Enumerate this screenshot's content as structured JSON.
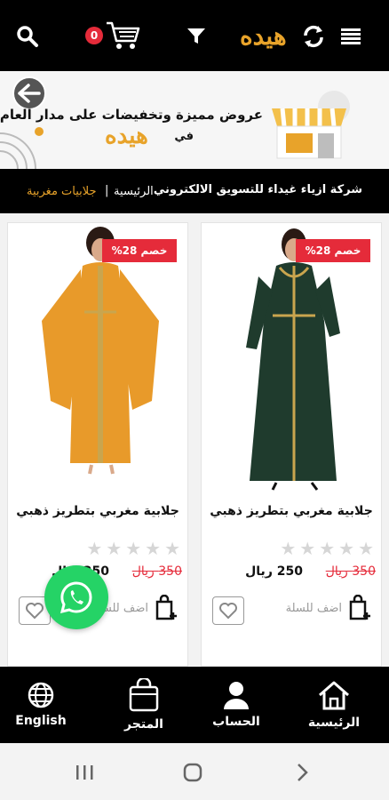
{
  "header": {
    "cart_count": "0",
    "logo_text": "هيده",
    "icons": [
      "search-icon",
      "cart-icon",
      "filter-icon",
      "refresh-icon",
      "menu-icon"
    ]
  },
  "banner": {
    "line1": "عروض مميزة وتخفيضات على مدار العام",
    "line2": "في",
    "logo_text": "هيده"
  },
  "breadcrumb": {
    "company": "شركة ازياء غيداء للتسويق الالكتروني",
    "home": "الرئيسية",
    "separator": "|",
    "category": "جلابيات مغربية"
  },
  "products": [
    {
      "title": "جلابية مغربي بتطريز ذهبي",
      "discount": "خصم 28%",
      "price": "250 ريال",
      "old_price": "350 ريال",
      "rating": 0,
      "add_to_cart": "اضف للسلة",
      "dress_color": "#1f3b2d"
    },
    {
      "title": "جلابية مغربي بتطريز ذهبي",
      "discount": "خصم 28%",
      "price": "250 ريال",
      "old_price": "350 ريال",
      "rating": 0,
      "add_to_cart": "اضف للسلة",
      "dress_color": "#e89a2a"
    }
  ],
  "bottom_nav": {
    "home": "الرئيسية",
    "account": "الحساب",
    "store": "المتجر",
    "language": "English"
  },
  "colors": {
    "accent": "#e8a32a",
    "badge": "#e52b3a",
    "whatsapp": "#25d366"
  }
}
